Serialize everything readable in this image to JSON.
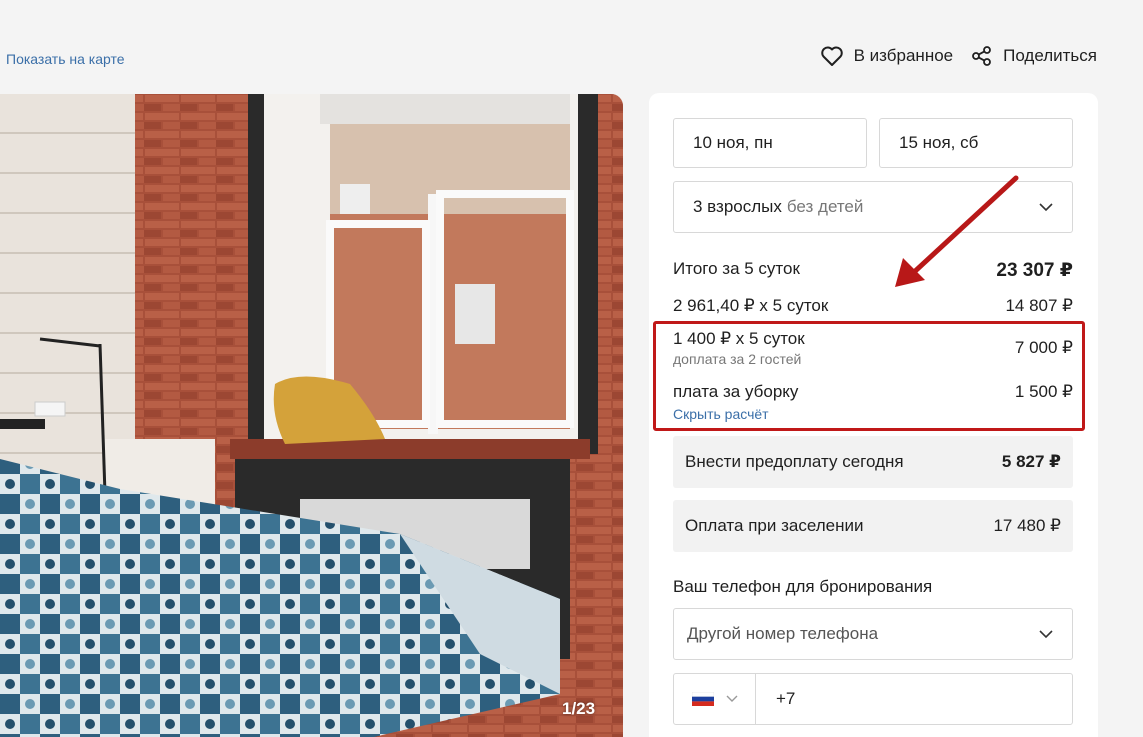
{
  "header": {
    "map_link": "Показать на карте",
    "favorite_label": "В избранное",
    "share_label": "Поделиться"
  },
  "gallery": {
    "counter": "1/23"
  },
  "booking": {
    "date_in": "10 ноя, пн",
    "date_out": "15 ноя, сб",
    "guests_main": "3 взрослых",
    "guests_sub": "без детей",
    "total_label": "Итого за 5 суток",
    "total_value": "23 307 ₽",
    "base_label": "2 961,40 ₽ х 5 суток",
    "base_value": "14 807 ₽",
    "extra_label": "1 400 ₽ х 5 суток",
    "extra_sub": "доплата за 2 гостей",
    "extra_value": "7 000 ₽",
    "cleaning_label": "плата за уборку",
    "cleaning_value": "1 500 ₽",
    "hide_link": "Скрыть расчёт",
    "prepay_label": "Внести предоплату сегодня",
    "prepay_value": "5 827 ₽",
    "checkin_label": "Оплата при заселении",
    "checkin_value": "17 480 ₽",
    "phone_label": "Ваш телефон для бронирования",
    "phone_select": "Другой номер телефона",
    "phone_prefix": "+7"
  },
  "colors": {
    "link": "#3b6fa8",
    "highlight": "#c01818"
  },
  "icons": [
    "heart-icon",
    "share-icon",
    "chevron-down-icon",
    "russia-flag-icon"
  ]
}
